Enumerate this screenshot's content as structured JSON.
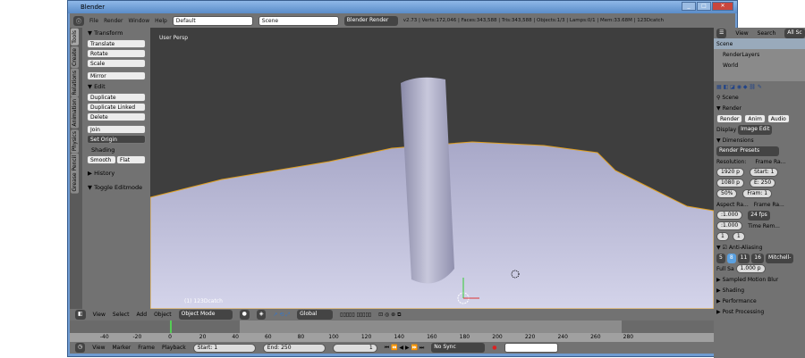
{
  "window": {
    "title": "Blender"
  },
  "header": {
    "menus": [
      "File",
      "Render",
      "Window",
      "Help"
    ],
    "layout": "Default",
    "scene": "Scene",
    "engine": "Blender Render",
    "stats": "v2.73 | Verts:172,046 | Faces:343,588 | Tris:343,588 | Objects:1/3 | Lamps:0/1 | Mem:33.68M | 123Dcatch"
  },
  "tools": {
    "tabs": [
      "Tools",
      "Create",
      "Relations",
      "Animation",
      "Physics",
      "Grease Pencil"
    ],
    "transform": "Transform",
    "transform_buttons": [
      "Translate",
      "Rotate",
      "Scale",
      "Mirror"
    ],
    "edit": "Edit",
    "edit_buttons": [
      "Duplicate",
      "Duplicate Linked",
      "Delete",
      "Join"
    ],
    "set_origin": "Set Origin",
    "shading": "Shading",
    "smooth": "Smooth",
    "flat": "Flat",
    "history": "History",
    "toggle_editmode": "Toggle Editmode"
  },
  "viewport": {
    "view_label": "User Persp",
    "object_label": "(1) 123Dcatch"
  },
  "outliner": {
    "view": "View",
    "search": "Search",
    "all": "All Sc",
    "items": [
      "Scene",
      "RenderLayers",
      "World"
    ]
  },
  "properties": {
    "context": "Scene",
    "render": "Render",
    "render_btns": [
      "Render",
      "Anim",
      "Audio"
    ],
    "display_label": "Display",
    "display_value": "Image Edit",
    "dimensions": "Dimensions",
    "presets": "Render Presets",
    "resolution": "Resolution:",
    "res_x": "1920 p",
    "res_y": "1080 p",
    "res_pct": "50%",
    "frame_range": "Frame Ra...",
    "start": "Start: 1",
    "end": "E: 250",
    "frame": "Fram: 1",
    "aspect": "Aspect Ra...",
    "asp_x": ":1.000",
    "asp_y": ":1.000",
    "frame_rate": "Frame Ra...",
    "fps": "24 fps",
    "time_remap": "Time Rem...",
    "remap_a": "1",
    "remap_b": "1",
    "anti_aliasing": "Anti-Aliasing",
    "aa_samples": [
      "5",
      "8",
      "11",
      "16"
    ],
    "filter": "Mitchell-",
    "full_sample": "Full Sa",
    "filter_size": "1.000 p",
    "sampled_motion": "Sampled Motion Blur",
    "shading": "Shading",
    "performance": "Performance",
    "post_processing": "Post Processing"
  },
  "view3d_header": {
    "menus": [
      "View",
      "Select",
      "Add",
      "Object"
    ],
    "mode": "Object Mode",
    "orientation": "Global"
  },
  "timeline": {
    "ticks": [
      "-40",
      "-20",
      "0",
      "20",
      "40",
      "60",
      "80",
      "100",
      "120",
      "140",
      "160",
      "180",
      "200",
      "220",
      "240",
      "260",
      "280"
    ],
    "current_frame": 0,
    "menus": [
      "View",
      "Marker",
      "Frame",
      "Playback"
    ],
    "start_label": "Start:",
    "start": "1",
    "end_label": "End:",
    "end": "250",
    "current": "1",
    "sync": "No Sync"
  }
}
